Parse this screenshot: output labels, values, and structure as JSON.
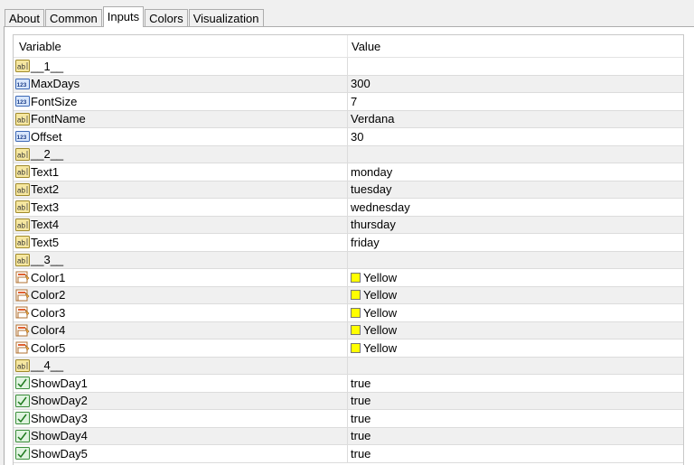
{
  "tabs": [
    {
      "label": "About",
      "active": false
    },
    {
      "label": "Common",
      "active": false
    },
    {
      "label": "Inputs",
      "active": true
    },
    {
      "label": "Colors",
      "active": false
    },
    {
      "label": "Visualization",
      "active": false
    }
  ],
  "grid": {
    "columns": {
      "variable": "Variable",
      "value": "Value"
    },
    "rows": [
      {
        "variable": "__1__",
        "value": "",
        "icon": "string-icon"
      },
      {
        "variable": "MaxDays",
        "value": "300",
        "icon": "integer-icon"
      },
      {
        "variable": "FontSize",
        "value": "7",
        "icon": "integer-icon"
      },
      {
        "variable": "FontName",
        "value": "Verdana",
        "icon": "string-icon"
      },
      {
        "variable": "Offset",
        "value": "30",
        "icon": "integer-icon"
      },
      {
        "variable": "__2__",
        "value": "",
        "icon": "string-icon"
      },
      {
        "variable": "Text1",
        "value": "monday",
        "icon": "string-icon"
      },
      {
        "variable": "Text2",
        "value": "tuesday",
        "icon": "string-icon"
      },
      {
        "variable": "Text3",
        "value": "wednesday",
        "icon": "string-icon"
      },
      {
        "variable": "Text4",
        "value": "thursday",
        "icon": "string-icon"
      },
      {
        "variable": "Text5",
        "value": "friday",
        "icon": "string-icon"
      },
      {
        "variable": "__3__",
        "value": "",
        "icon": "string-icon"
      },
      {
        "variable": "Color1",
        "value": "Yellow",
        "icon": "color-icon",
        "swatch": "#ffff00"
      },
      {
        "variable": "Color2",
        "value": "Yellow",
        "icon": "color-icon",
        "swatch": "#ffff00"
      },
      {
        "variable": "Color3",
        "value": "Yellow",
        "icon": "color-icon",
        "swatch": "#ffff00"
      },
      {
        "variable": "Color4",
        "value": "Yellow",
        "icon": "color-icon",
        "swatch": "#ffff00"
      },
      {
        "variable": "Color5",
        "value": "Yellow",
        "icon": "color-icon",
        "swatch": "#ffff00"
      },
      {
        "variable": "__4__",
        "value": "",
        "icon": "string-icon"
      },
      {
        "variable": "ShowDay1",
        "value": "true",
        "icon": "bool-icon"
      },
      {
        "variable": "ShowDay2",
        "value": "true",
        "icon": "bool-icon"
      },
      {
        "variable": "ShowDay3",
        "value": "true",
        "icon": "bool-icon"
      },
      {
        "variable": "ShowDay4",
        "value": "true",
        "icon": "bool-icon"
      },
      {
        "variable": "ShowDay5",
        "value": "true",
        "icon": "bool-icon"
      }
    ]
  }
}
